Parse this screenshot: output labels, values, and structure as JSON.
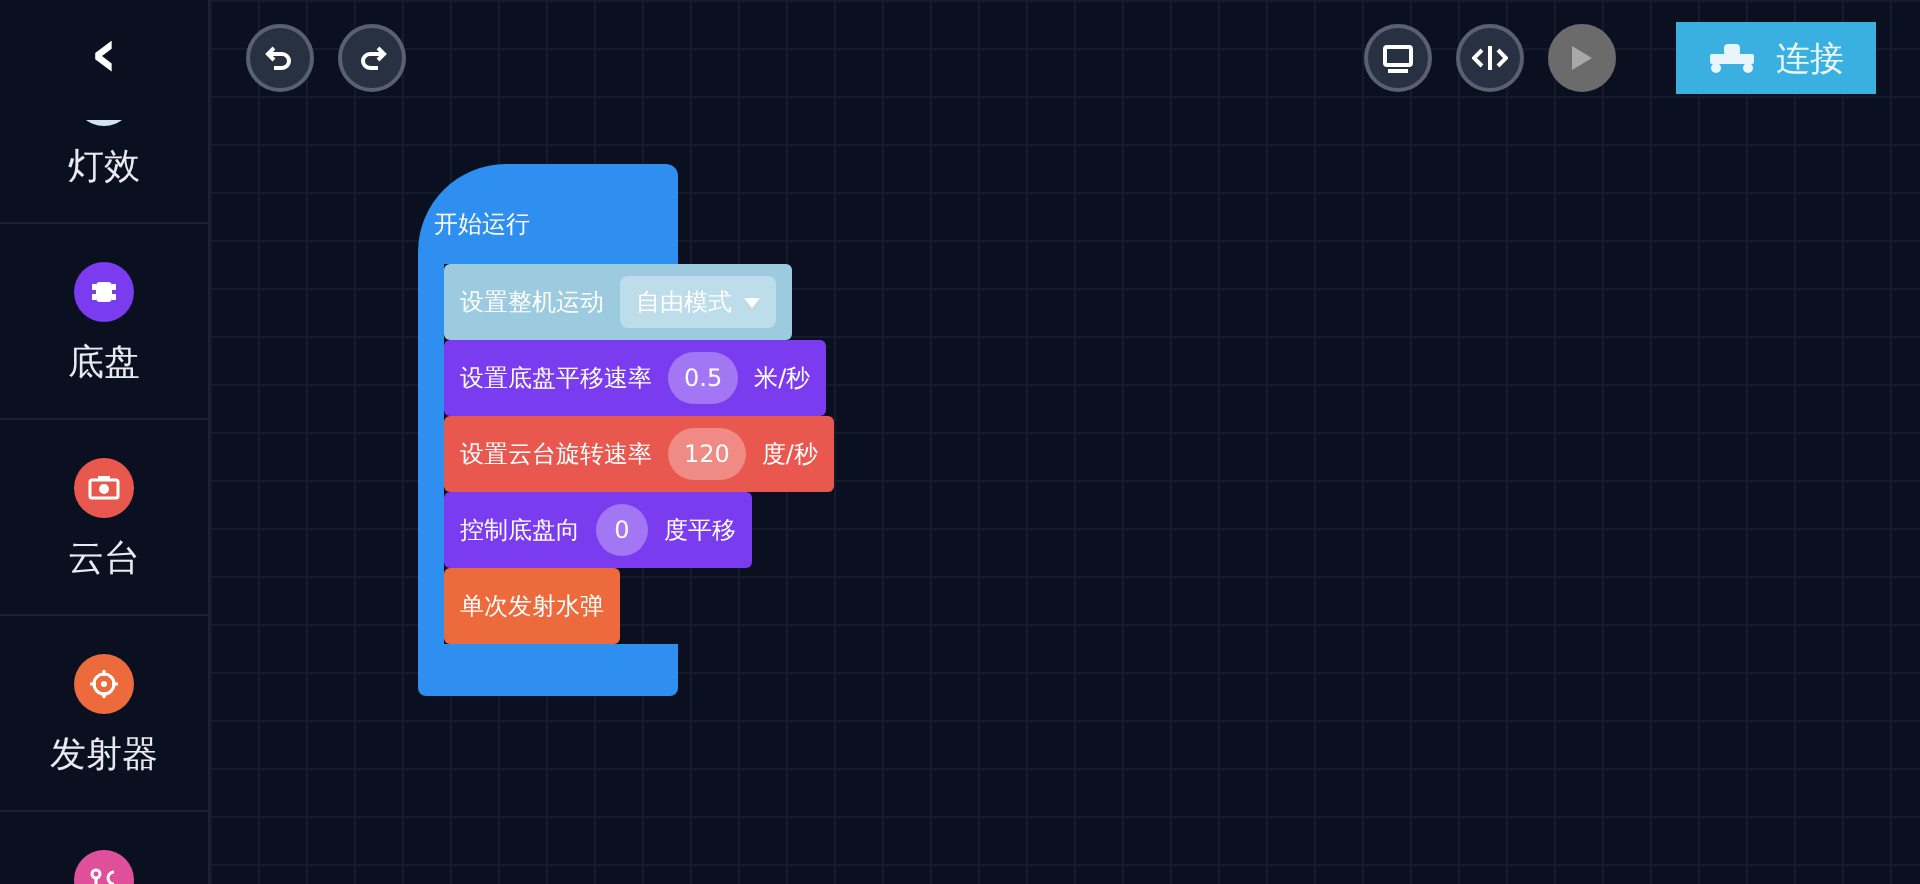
{
  "sidebar": {
    "back": "‹",
    "items": [
      {
        "label": "灯效",
        "color": "#cfe3f0"
      },
      {
        "label": "底盘",
        "color": "#7b3cf0"
      },
      {
        "label": "云台",
        "color": "#e8584f"
      },
      {
        "label": "发射器",
        "color": "#ec6a3c"
      },
      {
        "color": "#e0509a"
      }
    ]
  },
  "toolbar": {
    "connect": "连接",
    "play_disabled": true
  },
  "script": {
    "event": "开始运行",
    "blocks": [
      {
        "color": "#9ccbe0",
        "parts": [
          {
            "kind": "label",
            "text": "设置整机运动"
          },
          {
            "kind": "dropdown",
            "text": "自由模式"
          }
        ]
      },
      {
        "color": "#7b3cf0",
        "parts": [
          {
            "kind": "label",
            "text": "设置底盘平移速率"
          },
          {
            "kind": "number",
            "text": "0.5"
          },
          {
            "kind": "label",
            "text": "米/秒"
          }
        ]
      },
      {
        "color": "#e8584f",
        "parts": [
          {
            "kind": "label",
            "text": "设置云台旋转速率"
          },
          {
            "kind": "number",
            "text": "120"
          },
          {
            "kind": "label",
            "text": "度/秒"
          }
        ]
      },
      {
        "color": "#7b3cf0",
        "parts": [
          {
            "kind": "label",
            "text": "控制底盘向"
          },
          {
            "kind": "number",
            "text": "0"
          },
          {
            "kind": "label",
            "text": "度平移"
          }
        ]
      },
      {
        "color": "#ec6a3c",
        "parts": [
          {
            "kind": "label",
            "text": "单次发射水弹"
          }
        ]
      }
    ]
  }
}
